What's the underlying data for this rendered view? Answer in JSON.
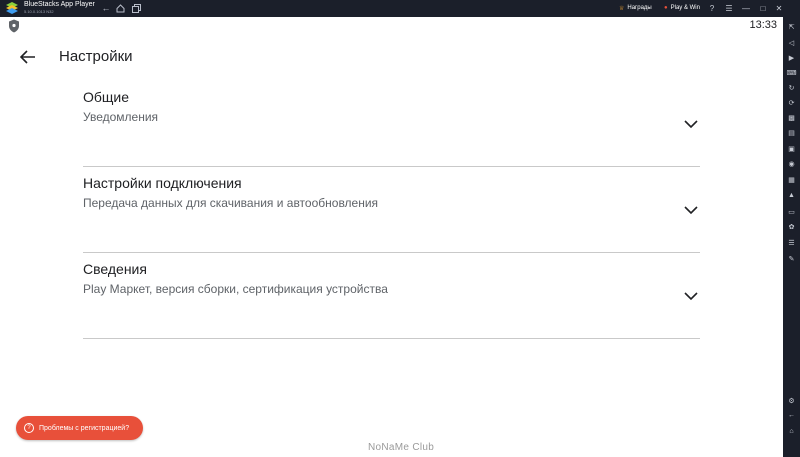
{
  "window": {
    "app_title": "BlueStacks App Player",
    "app_version": "5.10.0.1013 N32",
    "rewards_label": "Награды",
    "play_win_label": "Play & Win"
  },
  "status": {
    "time": "13:33"
  },
  "header": {
    "title": "Настройки"
  },
  "sections": [
    {
      "title": "Общие",
      "subtitle": "Уведомления"
    },
    {
      "title": "Настройки подключения",
      "subtitle": "Передача данных для скачивания и автообновления"
    },
    {
      "title": "Сведения",
      "subtitle": "Play Маркет, версия сборки, сертификация устройства"
    }
  ],
  "help_chip": {
    "label": "Проблемы с регистрацией?"
  },
  "watermark": {
    "text": "NoNaMe Club"
  },
  "colors": {
    "accent": "#e8503a",
    "chrome": "#1b1f2a",
    "text": "#202124",
    "subtext": "#5f6368",
    "divider": "#c9c9c9"
  },
  "icons": {
    "titlebar": [
      "bluestacks-logo",
      "back-icon",
      "home-icon",
      "multi-instance-icon",
      "crown-icon",
      "play-win-icon",
      "help-icon",
      "menu-icon",
      "minimize-icon",
      "maximize-icon",
      "close-icon"
    ],
    "sidebar": [
      "fullscreen-icon",
      "volume-icon",
      "media-icon",
      "keyboard-icon",
      "rotate-icon",
      "refresh-icon",
      "macro-icon",
      "performance-icon",
      "screenshot-icon",
      "record-icon",
      "gallery-icon",
      "apk-icon",
      "resize-icon",
      "eco-icon",
      "layers-icon",
      "script-icon",
      "settings-icon",
      "back-icon",
      "home-icon"
    ]
  }
}
